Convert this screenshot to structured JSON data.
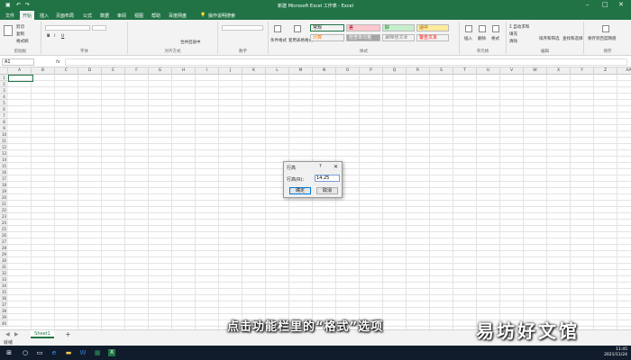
{
  "app": {
    "title": "新建 Microsoft Excel 工作表 - Excel"
  },
  "tabs": [
    "文件",
    "开始",
    "插入",
    "页面布局",
    "公式",
    "数据",
    "审阅",
    "视图",
    "帮助",
    "百度网盘",
    "操作说明搜索"
  ],
  "ribbon": {
    "clipboard": {
      "label": "剪贴板",
      "cut": "剪切",
      "copy": "复制",
      "format_painter": "格式刷"
    },
    "font": {
      "label": "字体"
    },
    "alignment": {
      "label": "对齐方式",
      "merge": "合并后居中"
    },
    "number": {
      "label": "数字"
    },
    "styles": {
      "label": "样式",
      "conditional": "条件格式",
      "table_format": "套用表格格式",
      "cells": [
        {
          "text": "常规",
          "bg": "#ffffff",
          "fg": "#222222"
        },
        {
          "text": "差",
          "bg": "#ffc7ce",
          "fg": "#9c0006"
        },
        {
          "text": "好",
          "bg": "#c6efce",
          "fg": "#006100"
        },
        {
          "text": "适中",
          "bg": "#ffeb9c",
          "fg": "#9c5700"
        },
        {
          "text": "计算",
          "bg": "#f2f2f2",
          "fg": "#fa7d00"
        },
        {
          "text": "检查单元格",
          "bg": "#a5a5a5",
          "fg": "#ffffff"
        },
        {
          "text": "解释性文本",
          "bg": "#ffffff",
          "fg": "#7f7f7f"
        },
        {
          "text": "警告文本",
          "bg": "#ffffff",
          "fg": "#ff0000"
        }
      ]
    },
    "cells_group": {
      "label": "单元格",
      "insert": "插入",
      "delete": "删除",
      "format": "格式"
    },
    "editing": {
      "label": "编辑",
      "autosum": "自动求和",
      "fill": "填充",
      "clear": "清除",
      "sort": "排序和筛选",
      "find": "查找和选择"
    },
    "save": {
      "label": "保存",
      "save_baidu": "保存到百度网盘"
    }
  },
  "formula_bar": {
    "name_box": "A1",
    "fx": "fx"
  },
  "grid": {
    "columns": [
      "A",
      "B",
      "C",
      "D",
      "E",
      "F",
      "G",
      "H",
      "I",
      "J",
      "K",
      "L",
      "M",
      "N",
      "O",
      "P",
      "Q",
      "R",
      "S",
      "T",
      "U",
      "V",
      "W",
      "X",
      "Y",
      "Z",
      "AA"
    ],
    "rows": [
      "1",
      "2",
      "3",
      "4",
      "5",
      "6",
      "7",
      "8",
      "9",
      "10",
      "11",
      "12",
      "13",
      "14",
      "15",
      "16",
      "17",
      "18",
      "19",
      "20",
      "21",
      "22",
      "23",
      "24",
      "25",
      "26",
      "27",
      "28",
      "29",
      "30",
      "31",
      "32",
      "33",
      "34",
      "35",
      "36",
      "37",
      "38",
      "39",
      "40"
    ]
  },
  "sheet": {
    "tab": "Sheet1",
    "add": "+"
  },
  "status": {
    "ready": "就绪"
  },
  "dialog": {
    "title": "行高",
    "help": "?",
    "close": "✕",
    "label": "行高(R):",
    "value": "14.25",
    "ok": "确定",
    "cancel": "取消"
  },
  "overlay": {
    "subtitle": "点击功能栏里的“格式”选项",
    "watermark": "易坊好文馆"
  },
  "taskbar": {
    "time": "11:45",
    "date": "2021/11/24"
  }
}
